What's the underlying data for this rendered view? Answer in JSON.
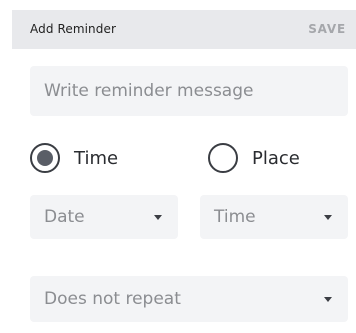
{
  "header": {
    "title": "Add Reminder",
    "save_label": "SAVE"
  },
  "message": {
    "placeholder": "Write reminder message",
    "value": ""
  },
  "trigger": {
    "options": [
      {
        "label": "Time",
        "selected": true
      },
      {
        "label": "Place",
        "selected": false
      }
    ]
  },
  "date_select": {
    "value": "Date"
  },
  "time_select": {
    "value": "Time"
  },
  "repeat_select": {
    "value": "Does not repeat"
  },
  "icons": {
    "dropdown": "caret-down-icon",
    "radio_selected": "radio-selected-icon",
    "radio_unselected": "radio-unselected-icon"
  },
  "colors": {
    "header_bg": "#e8e9ec",
    "field_bg": "#f3f4f6",
    "save_text": "#a5a7ab",
    "placeholder_text": "#8b8d91",
    "radio": "#3a3d43"
  }
}
